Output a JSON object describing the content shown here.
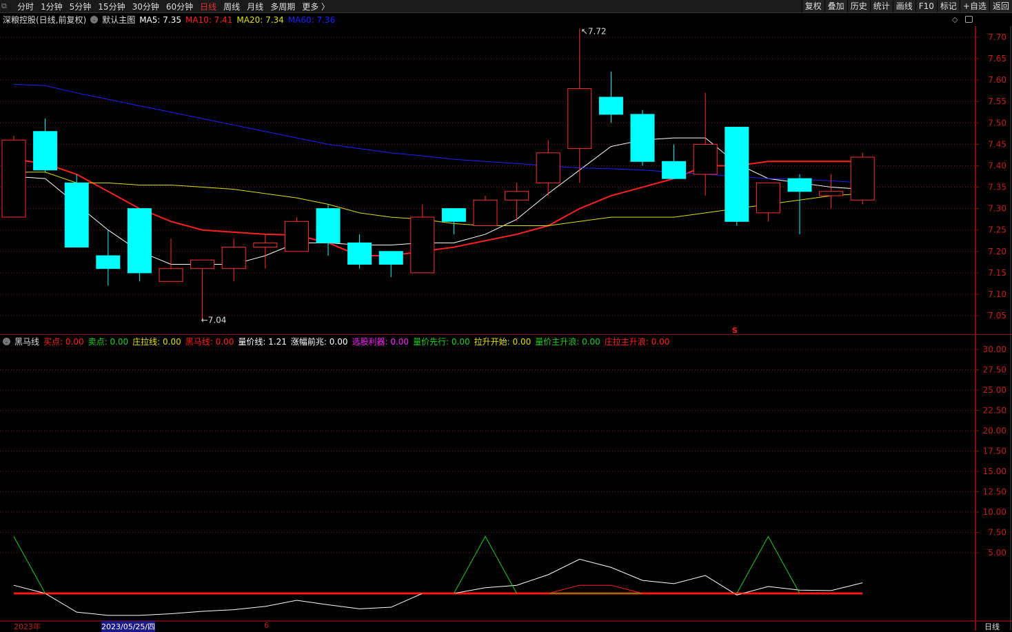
{
  "toolbar": {
    "periods": [
      "分时",
      "1分钟",
      "5分钟",
      "15分钟",
      "30分钟",
      "60分钟",
      "日线",
      "周线",
      "月线",
      "多周期",
      "更多 〉"
    ],
    "active_period": "日线",
    "buttons": [
      "复权",
      "叠加",
      "历史",
      "统计",
      "画线",
      "F10",
      "标记",
      "+自选",
      "返回"
    ]
  },
  "main_legend": {
    "title": "深粮控股(日线,前复权)",
    "template": "默认主图",
    "ma5": "MA5: 7.35",
    "ma10": "MA10: 7.41",
    "ma20": "MA20: 7.34",
    "ma60": "MA60: 7.36"
  },
  "sub_legend": {
    "name": "黑马线",
    "items": [
      {
        "label": "买点: 0.00",
        "color": "#ff2020"
      },
      {
        "label": "卖点: 0.00",
        "color": "#20d020"
      },
      {
        "label": "庄拉线: 0.00",
        "color": "#e0e000"
      },
      {
        "label": "黑马线: 0.00",
        "color": "#ff2020"
      },
      {
        "label": "量价线: 1.21",
        "color": "#ffffff"
      },
      {
        "label": "涨幅前兆: 0.00",
        "color": "#ffffff"
      },
      {
        "label": "选股利器: 0.00",
        "color": "#ff20ff"
      },
      {
        "label": "量价先行: 0.00",
        "color": "#20d020"
      },
      {
        "label": "拉升开始: 0.00",
        "color": "#e0e000"
      },
      {
        "label": "量价主升浪: 0.00",
        "color": "#20d020"
      },
      {
        "label": "庄拉主升浪: 0.00",
        "color": "#ff2020"
      }
    ]
  },
  "annotations": {
    "high": "7.72",
    "low": "7.04",
    "marker": "S"
  },
  "datebar": {
    "year": "2023年",
    "cursor_date": "2023/05/25/四",
    "month": "6",
    "period": "日线"
  },
  "chart_data": [
    {
      "type": "candlestick",
      "title": "深粮控股 日线",
      "ylim": [
        7.0,
        7.75
      ],
      "yticks": [
        "7.70",
        "7.65",
        "7.60",
        "7.55",
        "7.50",
        "7.45",
        "7.40",
        "7.35",
        "7.30",
        "7.25",
        "7.20",
        "7.15",
        "7.10",
        "7.05"
      ],
      "ohlc": [
        [
          7.28,
          7.47,
          7.28,
          7.46
        ],
        [
          7.48,
          7.51,
          7.385,
          7.39
        ],
        [
          7.36,
          7.38,
          7.21,
          7.21
        ],
        [
          7.19,
          7.25,
          7.12,
          7.16
        ],
        [
          7.3,
          7.3,
          7.13,
          7.15
        ],
        [
          7.13,
          7.23,
          7.13,
          7.16
        ],
        [
          7.16,
          7.18,
          7.04,
          7.18
        ],
        [
          7.16,
          7.23,
          7.13,
          7.21
        ],
        [
          7.21,
          7.24,
          7.16,
          7.22
        ],
        [
          7.2,
          7.28,
          7.2,
          7.27
        ],
        [
          7.3,
          7.31,
          7.19,
          7.22
        ],
        [
          7.22,
          7.24,
          7.16,
          7.17
        ],
        [
          7.2,
          7.2,
          7.14,
          7.17
        ],
        [
          7.15,
          7.31,
          7.15,
          7.28
        ],
        [
          7.3,
          7.3,
          7.24,
          7.27
        ],
        [
          7.26,
          7.33,
          7.26,
          7.32
        ],
        [
          7.32,
          7.36,
          7.27,
          7.34
        ],
        [
          7.36,
          7.46,
          7.33,
          7.43
        ],
        [
          7.44,
          7.72,
          7.36,
          7.58
        ],
        [
          7.56,
          7.62,
          7.5,
          7.52
        ],
        [
          7.52,
          7.53,
          7.4,
          7.41
        ],
        [
          7.41,
          7.45,
          7.37,
          7.37
        ],
        [
          7.38,
          7.57,
          7.33,
          7.45
        ],
        [
          7.49,
          7.49,
          7.26,
          7.27
        ],
        [
          7.29,
          7.36,
          7.27,
          7.36
        ],
        [
          7.37,
          7.38,
          7.24,
          7.34
        ],
        [
          7.33,
          7.38,
          7.3,
          7.34
        ],
        [
          7.32,
          7.43,
          7.31,
          7.42
        ]
      ],
      "series": [
        {
          "name": "MA5",
          "color": "#ffffff",
          "values": [
            7.375,
            7.37,
            7.31,
            7.25,
            7.2,
            7.17,
            7.17,
            7.17,
            7.19,
            7.22,
            7.22,
            7.215,
            7.215,
            7.22,
            7.22,
            7.24,
            7.275,
            7.335,
            7.39,
            7.445,
            7.46,
            7.465,
            7.465,
            7.405,
            7.37,
            7.36,
            7.35,
            7.345
          ]
        },
        {
          "name": "MA10",
          "color": "#ff2020",
          "values": [
            7.415,
            7.405,
            7.38,
            7.34,
            7.3,
            7.27,
            7.25,
            7.245,
            7.24,
            7.238,
            7.22,
            7.19,
            7.19,
            7.2,
            7.21,
            7.225,
            7.24,
            7.26,
            7.3,
            7.33,
            7.35,
            7.37,
            7.4,
            7.4,
            7.41,
            7.41,
            7.41,
            7.41
          ]
        },
        {
          "name": "MA20",
          "color": "#e0e000",
          "values": [
            7.385,
            7.385,
            7.36,
            7.36,
            7.355,
            7.355,
            7.35,
            7.345,
            7.335,
            7.325,
            7.31,
            7.29,
            7.28,
            7.275,
            7.265,
            7.26,
            7.26,
            7.26,
            7.27,
            7.28,
            7.28,
            7.28,
            7.29,
            7.3,
            7.31,
            7.32,
            7.33,
            7.335
          ]
        },
        {
          "name": "MA60",
          "color": "#2020ff",
          "values": [
            7.59,
            7.587,
            7.57,
            7.555,
            7.54,
            7.525,
            7.51,
            7.495,
            7.48,
            7.465,
            7.45,
            7.44,
            7.43,
            7.423,
            7.415,
            7.41,
            7.405,
            7.4,
            7.395,
            7.393,
            7.39,
            7.385,
            7.38,
            7.375,
            7.37,
            7.368,
            7.365,
            7.36
          ]
        }
      ]
    },
    {
      "type": "line",
      "title": "黑马线",
      "ylim": [
        -3,
        32
      ],
      "yticks": [
        "30.00",
        "27.50",
        "25.00",
        "22.50",
        "20.00",
        "17.50",
        "15.00",
        "12.50",
        "10.00",
        "7.50",
        "5.00"
      ],
      "series": [
        {
          "name": "量价线",
          "color": "#ffffff",
          "values": [
            1.0,
            0,
            -2.3,
            -2.7,
            -2.7,
            -2.5,
            -2.2,
            -2.0,
            -1.6,
            -0.85,
            -1.4,
            -1.9,
            -1.7,
            0,
            0,
            0.7,
            1.0,
            2.3,
            4.2,
            3.2,
            1.6,
            1.2,
            2.2,
            -0.2,
            0.85,
            0.4,
            0.35,
            1.3
          ]
        },
        {
          "name": "买点",
          "color": "#20d020",
          "values": [
            7,
            0,
            0,
            0,
            0,
            0,
            0,
            0,
            0,
            0,
            0,
            0,
            0,
            0,
            0,
            7,
            0,
            0,
            0,
            0,
            0,
            0,
            0,
            0,
            7,
            0,
            0,
            0
          ]
        },
        {
          "name": "庄拉线",
          "color": "#ff2020",
          "values": [
            0,
            0,
            0,
            0,
            0,
            0,
            0,
            0,
            0,
            0,
            0,
            0,
            0,
            0,
            0,
            0,
            0,
            0,
            1.0,
            1.0,
            0,
            0,
            0,
            0,
            0,
            0,
            0,
            0
          ]
        }
      ]
    }
  ]
}
